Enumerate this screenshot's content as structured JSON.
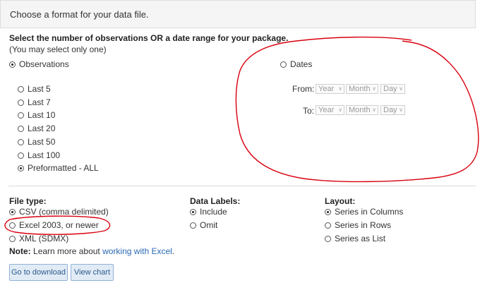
{
  "header": {
    "title": "Choose a format for your data file."
  },
  "range": {
    "heading": "Select the number of observations OR a date range for your package.",
    "subheading": "(You may select only one)",
    "observations_label": "Observations",
    "dates_label": "Dates",
    "options": [
      "Last 5",
      "Last 7",
      "Last 10",
      "Last 20",
      "Last 50",
      "Last 100",
      "Preformatted - ALL"
    ],
    "from_label": "From:",
    "to_label": "To:",
    "year_placeholder": "Year",
    "month_placeholder": "Month",
    "day_placeholder": "Day"
  },
  "file_type": {
    "heading": "File type:",
    "options": [
      "CSV (comma delimited)",
      "Excel 2003, or newer",
      "XML (SDMX)"
    ]
  },
  "data_labels": {
    "heading": "Data Labels:",
    "options": [
      "Include",
      "Omit"
    ]
  },
  "layout": {
    "heading": "Layout:",
    "options": [
      "Series in Columns",
      "Series in Rows",
      "Series as List"
    ]
  },
  "note": {
    "label": "Note:",
    "text": "Learn more about",
    "link": "working with Excel",
    "end": "."
  },
  "buttons": {
    "download": "Go to download",
    "chart": "View chart"
  },
  "colors": {
    "annotation": "#d8000f",
    "link": "#2a6ab5",
    "button_bg": "#e1ebf6"
  }
}
